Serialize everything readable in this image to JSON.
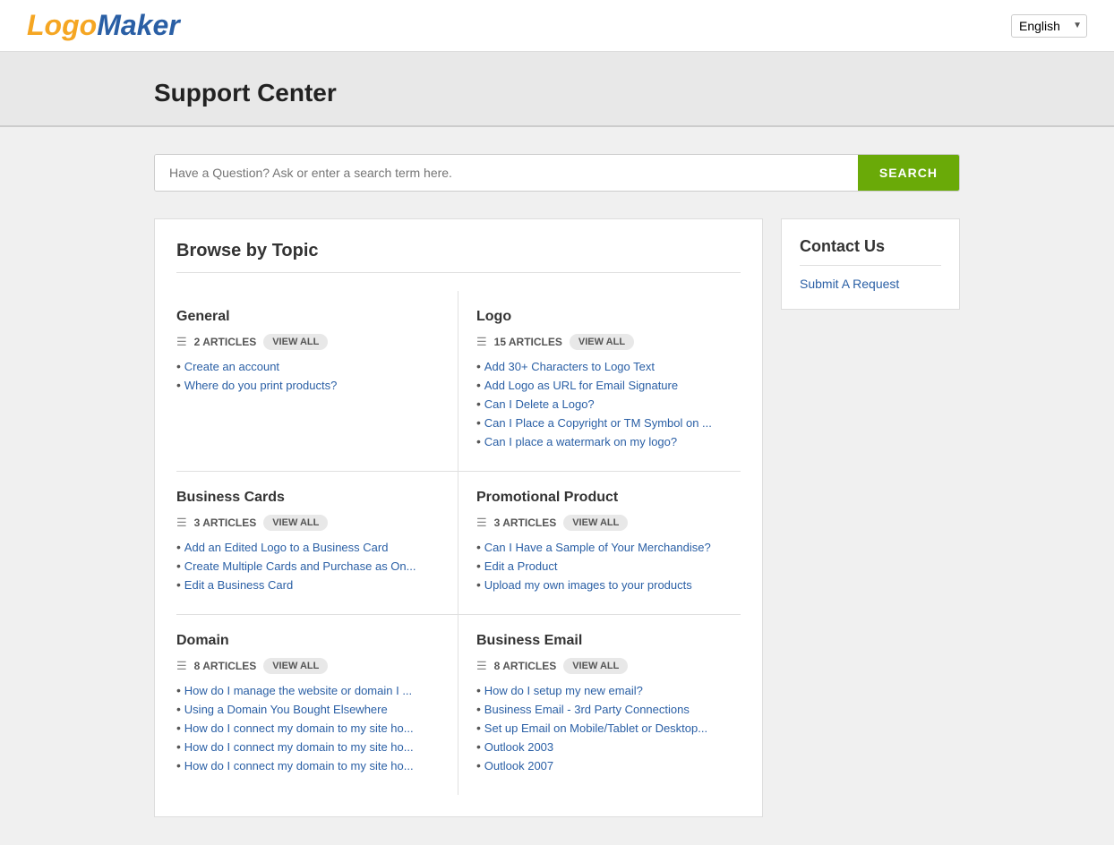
{
  "header": {
    "logo_logo": "Logo",
    "logo_maker": "Maker",
    "language": "English"
  },
  "support_banner": {
    "title": "Support Center"
  },
  "search": {
    "placeholder": "Have a Question? Ask or enter a search term here.",
    "button_label": "SEARCH"
  },
  "browse": {
    "title": "Browse by Topic",
    "topics": [
      {
        "id": "general",
        "title": "General",
        "article_count": "2 ARTICLES",
        "view_all_label": "VIEW ALL",
        "articles": [
          "Create an account",
          "Where do you print products?"
        ]
      },
      {
        "id": "logo",
        "title": "Logo",
        "article_count": "15 ARTICLES",
        "view_all_label": "VIEW ALL",
        "articles": [
          "Add 30+ Characters to Logo Text",
          "Add Logo as URL for Email Signature",
          "Can I Delete a Logo?",
          "Can I Place a Copyright or TM Symbol on ...",
          "Can I place a watermark on my logo?"
        ]
      },
      {
        "id": "business-cards",
        "title": "Business Cards",
        "article_count": "3 ARTICLES",
        "view_all_label": "VIEW ALL",
        "articles": [
          "Add an Edited Logo to a Business Card",
          "Create Multiple Cards and Purchase as On...",
          "Edit a Business Card"
        ]
      },
      {
        "id": "promotional-product",
        "title": "Promotional Product",
        "article_count": "3 ARTICLES",
        "view_all_label": "VIEW ALL",
        "articles": [
          "Can I Have a Sample of Your Merchandise?",
          "Edit a Product",
          "Upload my own images to your products"
        ]
      },
      {
        "id": "domain",
        "title": "Domain",
        "article_count": "8 ARTICLES",
        "view_all_label": "VIEW ALL",
        "articles": [
          "How do I manage the website or domain I ...",
          "Using a Domain You Bought Elsewhere",
          "How do I connect my domain to my site ho...",
          "How do I connect my domain to my site ho...",
          "How do I connect my domain to my site ho..."
        ]
      },
      {
        "id": "business-email",
        "title": "Business Email",
        "article_count": "8 ARTICLES",
        "view_all_label": "VIEW ALL",
        "articles": [
          "How do I setup my new email?",
          "Business Email - 3rd Party Connections",
          "Set up Email on Mobile/Tablet or Desktop...",
          "Outlook 2003",
          "Outlook 2007"
        ]
      }
    ]
  },
  "contact": {
    "title": "Contact Us",
    "submit_request_label": "Submit A Request"
  }
}
